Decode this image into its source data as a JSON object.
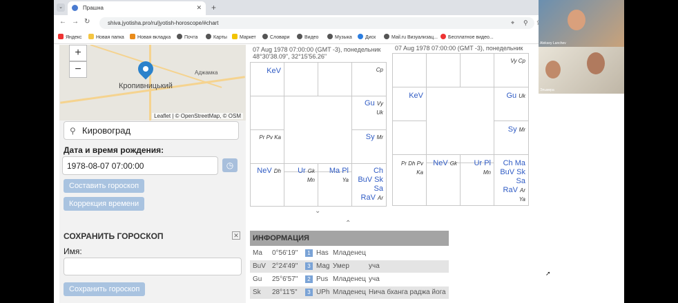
{
  "browser": {
    "tab_title": "Прашна",
    "url": "shiva.jyotisha.pro/ru/jyotish-horoscope/#chart",
    "bookmarks": [
      "Яндекс",
      "Новая папка",
      "Новая вкладка",
      "Почта",
      "Карты",
      "Маркет",
      "Словари",
      "Видео",
      "Музыка",
      "Диск",
      "Mail.ru Визуализац...",
      "Бесплатное видео..."
    ]
  },
  "map": {
    "city_label": "Кропивницький",
    "town_label": "Аджамка",
    "attribution": "Leaflet | © OpenStreetMap, © OSM"
  },
  "form": {
    "city_value": "Кировоград",
    "birth_label": "Дата и время рождения:",
    "birth_value": "1978-08-07 07:00:00",
    "build_button": "Составить гороскоп",
    "correction_button": "Коррекция времени"
  },
  "save": {
    "title": "СОХРАНИТЬ ГОРОСКОП",
    "name_label": "Имя:",
    "save_button": "Сохранить гороскоп"
  },
  "chart1": {
    "header1": "07 Aug 1978 07:00:00 (GMT -3), понедельник",
    "header2": "48°30'38.09\", 32°15'56.26\"",
    "cells": {
      "c1": "KeV",
      "c2": "Cp",
      "c3a": "Gu",
      "c3b": "Vy",
      "c3c": "Uk",
      "c4": "Pr Pv Ka",
      "c5": "Sy",
      "c5b": "Mr",
      "c6a": "NeV",
      "c6b": "Dh",
      "c7a": "Ur",
      "c7b": "Gk",
      "c7c": "Mn",
      "c8a": "Ma Pl",
      "c8b": "Ya",
      "c9a": "Ch",
      "c9b": "BuV Sk",
      "c9c": "Sa",
      "c9d": "RaV",
      "c9e": "Ar"
    }
  },
  "chart2": {
    "header": "07 Aug 1978 07:00:00 (GMT -3), понедельник",
    "cells": {
      "c1": "Vy Cp",
      "c2": "KeV",
      "c3a": "Gu",
      "c3b": "Uk",
      "c4": "Sy",
      "c4b": "Mr",
      "c5a": "Pr Dh Pv",
      "c5b": "Ka",
      "c6a": "NeV",
      "c6b": "Gk",
      "c7a": "Ur Pl",
      "c7b": "Mn",
      "c8a": "Ch Ma",
      "c8b": "BuV Sk",
      "c8c": "Sa",
      "c8d": "RaV",
      "c8e": "Ar",
      "c8f": "Ya"
    }
  },
  "info": {
    "title": "ИНФОРМАЦИЯ",
    "rows": [
      {
        "planet": "Ma",
        "deg": "0°56'19\"",
        "num": "1",
        "nak": "Has",
        "state": "Младенец",
        "extra": ""
      },
      {
        "planet": "BuV",
        "deg": "2°24'49\"",
        "num": "3",
        "nak": "Mag",
        "state": "Умер",
        "extra": "уча"
      },
      {
        "planet": "Gu",
        "deg": "25°6'57\"",
        "num": "2",
        "nak": "Pus",
        "state": "Младенец",
        "extra": "уча"
      },
      {
        "planet": "Sk",
        "deg": "28°11'5\"",
        "num": "3",
        "nak": "UPh",
        "state": "Младенец",
        "extra": "Нича бханга раджа йога"
      }
    ]
  },
  "video": {
    "person1": "Aleksey Lanchev",
    "person2": "Эльмира"
  }
}
